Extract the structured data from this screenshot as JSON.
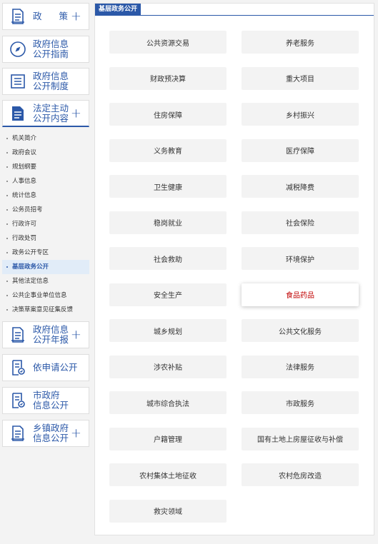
{
  "sidebar": {
    "menu": [
      {
        "label": "政 策",
        "has_plus": true,
        "icon": "document-list-icon"
      },
      {
        "label": "政府信息\n公开指南",
        "has_plus": false,
        "icon": "compass-icon"
      },
      {
        "label": "政府信息\n公开制度",
        "has_plus": false,
        "icon": "list-box-icon"
      },
      {
        "label": "法定主动\n公开内容",
        "has_plus": true,
        "icon": "document-filled-icon"
      }
    ],
    "submenu": [
      "机关简介",
      "政府会议",
      "规划纲要",
      "人事信息",
      "统计信息",
      "公务员招考",
      "行政许可",
      "行政处罚",
      "政务公开专区",
      "基层政务公开",
      "其他法定信息",
      "公共企事业单位信息",
      "决策草案意见征集反馈"
    ],
    "menu2": [
      {
        "label": "政府信息\n公开年报",
        "has_plus": true,
        "icon": "document-list-icon"
      },
      {
        "label": "依申请公开",
        "has_plus": false,
        "icon": "document-check-icon"
      },
      {
        "label": "市政府\n信息公开",
        "has_plus": false,
        "icon": "document-check-icon"
      },
      {
        "label": "乡镇政府\n信息公开",
        "has_plus": true,
        "icon": "document-list-icon"
      }
    ],
    "plus_symbol": "+"
  },
  "main": {
    "title": "基层政务公开",
    "buttons": [
      "公共资源交易",
      "养老服务",
      "财政预决算",
      "重大项目",
      "住房保障",
      "乡村振兴",
      "义务教育",
      "医疗保障",
      "卫生健康",
      "减税降费",
      "稳岗就业",
      "社会保险",
      "社会救助",
      "环境保护",
      "安全生产",
      "食品药品",
      "城乡规划",
      "公共文化服务",
      "涉农补贴",
      "法律服务",
      "城市综合执法",
      "市政服务",
      "户籍管理",
      "国有土地上房屋征收与补偿",
      "农村集体土地征收",
      "农村危房改造",
      "救灾领域"
    ]
  },
  "colors": {
    "accent": "#2b58a8",
    "active_text": "#c00000",
    "button_bg": "#f3f3f3"
  }
}
